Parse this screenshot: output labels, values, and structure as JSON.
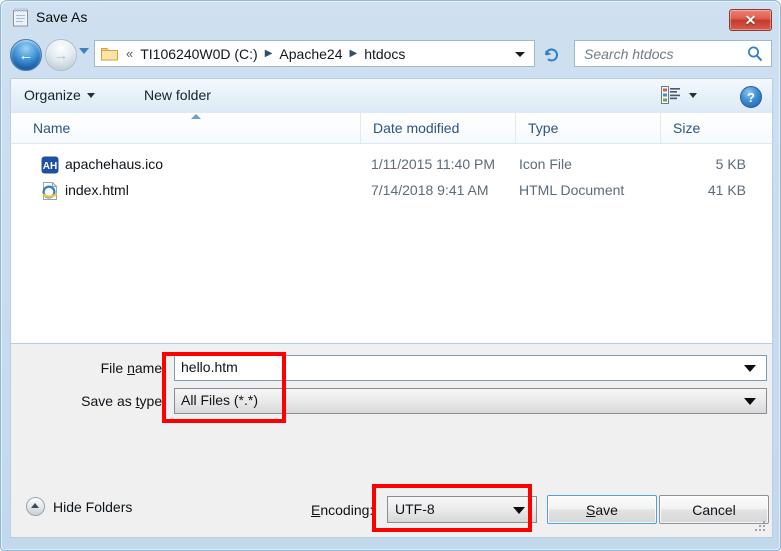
{
  "window": {
    "title": "Save As",
    "title_icon": "notepad-document-icon",
    "close_label": "✕"
  },
  "navbar": {
    "back_icon": "back-arrow-icon",
    "back_glyph": "←",
    "forward_icon": "forward-arrow-icon",
    "forward_glyph": "→",
    "history_dropdown_icon": "chevron-down-icon",
    "address_folder_icon": "folder-icon",
    "breadcrumb_overflow": "«",
    "breadcrumb": [
      "TI106240W0D (C:)",
      "Apache24",
      "htdocs"
    ],
    "breadcrumb_separator": "▶",
    "address_dropdown_icon": "chevron-down-icon",
    "refresh_icon": "refresh-icon",
    "search_placeholder": "Search htdocs",
    "search_value": "",
    "search_icon": "search-icon"
  },
  "toolbar": {
    "organize_label": "Organize",
    "organize_caret_icon": "triangle-down-icon",
    "new_folder_label": "New folder",
    "view_icon": "details-view-icon",
    "view_caret_icon": "triangle-down-icon",
    "help_label": "?",
    "help_icon": "help-icon"
  },
  "file_list": {
    "columns": [
      "Name",
      "Date modified",
      "Type",
      "Size"
    ],
    "sort_column": "Name",
    "sort_direction": "ascending",
    "rows": [
      {
        "icon": "apachehaus-ico-icon",
        "icon_text": "AH",
        "name": "apachehaus.ico",
        "date_modified": "1/11/2015 11:40 PM",
        "type": "Icon File",
        "size": "5 KB"
      },
      {
        "icon": "internet-explorer-html-icon",
        "icon_text": "e",
        "name": "index.html",
        "date_modified": "7/14/2018 9:41 AM",
        "type": "HTML Document",
        "size": "41 KB"
      }
    ]
  },
  "form": {
    "file_name_label_pre": "File ",
    "file_name_label_accel": "n",
    "file_name_label_post": "ame:",
    "file_name_value": "hello.htm",
    "file_name_caret_icon": "triangle-down-icon",
    "save_as_type_label_pre": "Save as ",
    "save_as_type_label_accel": "t",
    "save_as_type_label_post": "ype:",
    "save_as_type_value": "All Files  (*.*)",
    "save_as_type_caret_icon": "triangle-down-icon"
  },
  "footer": {
    "hide_folders_label": "Hide Folders",
    "hide_folders_icon": "collapse-up-icon",
    "encoding_label_pre": "",
    "encoding_label_accel": "E",
    "encoding_label_post": "ncoding:",
    "encoding_value": "UTF-8",
    "encoding_caret_icon": "triangle-down-icon",
    "save_label_pre": "",
    "save_label_accel": "S",
    "save_label_post": "ave",
    "cancel_label": "Cancel",
    "resize_grip_icon": "resize-grip-icon"
  },
  "annotations": {
    "highlight_color": "#fe0000",
    "boxes": [
      "file-name-and-type-fields",
      "encoding-dropdown"
    ]
  },
  "colors": {
    "frame_blue": "#c2d8ec",
    "panel_gray": "#f0f0f0",
    "accent_blue": "#4aa3dd",
    "close_red": "#c33a2c"
  }
}
